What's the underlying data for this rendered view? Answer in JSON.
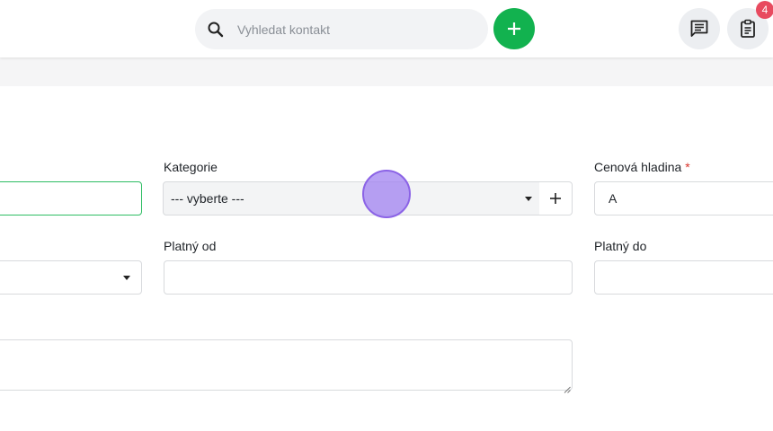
{
  "header": {
    "search": {
      "placeholder": "Vyhledat kontakt",
      "icon": "search-icon"
    },
    "add_button": {
      "icon": "plus-icon",
      "color": "#12b24f"
    },
    "messages_button": {
      "icon": "chat-icon"
    },
    "tasks_button": {
      "icon": "clipboard-icon",
      "badge": "4",
      "badge_color": "#e84a5f"
    }
  },
  "form": {
    "kategorie": {
      "label": "Kategorie",
      "value": "--- vyberte ---"
    },
    "cenova_hladina": {
      "label": "Cenová hladina",
      "required_mark": "*",
      "value": "A"
    },
    "platny_od": {
      "label": "Platný od",
      "value": ""
    },
    "platny_do": {
      "label": "Platný do",
      "value": ""
    }
  },
  "colors": {
    "accent": "#12b24f",
    "focus_border": "#2ebd63",
    "required": "#d9342b"
  }
}
